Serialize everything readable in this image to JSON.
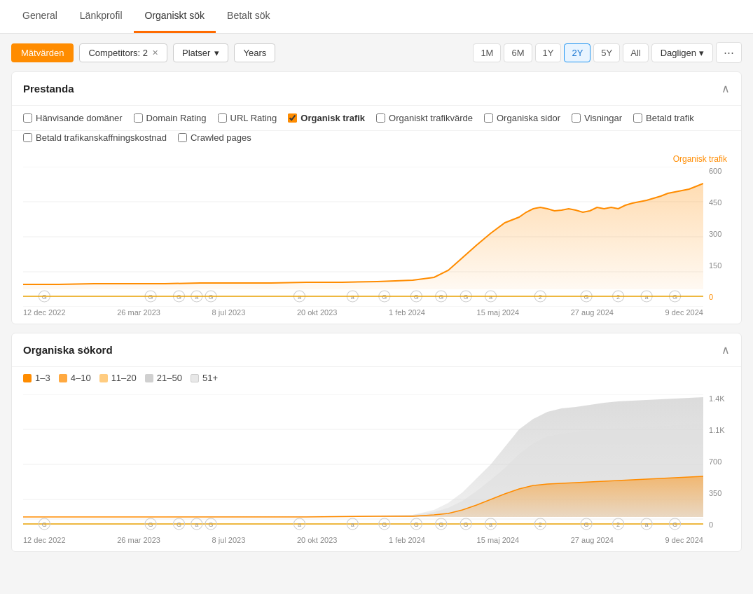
{
  "tabs": [
    {
      "label": "General",
      "active": false
    },
    {
      "label": "Länkprofil",
      "active": false
    },
    {
      "label": "Organiskt sök",
      "active": true
    },
    {
      "label": "Betalt sök",
      "active": false
    }
  ],
  "toolbar": {
    "metrics_label": "Mätvärden",
    "competitors_label": "Competitors: 2",
    "platser_label": "Platser",
    "years_label": "Years",
    "time_buttons": [
      "1M",
      "6M",
      "1Y",
      "2Y",
      "5Y",
      "All"
    ],
    "active_time": "2Y",
    "dagligen_label": "Dagligen",
    "more_icon": "⋯"
  },
  "prestanda": {
    "title": "Prestanda",
    "checkboxes": [
      {
        "label": "Hänvisande domäner",
        "checked": false
      },
      {
        "label": "Domain Rating",
        "checked": false
      },
      {
        "label": "URL Rating",
        "checked": false
      },
      {
        "label": "Organisk trafik",
        "checked": true,
        "highlight": true
      },
      {
        "label": "Organiskt trafikvärde",
        "checked": false
      },
      {
        "label": "Organiska sidor",
        "checked": false
      },
      {
        "label": "Visningar",
        "checked": false
      },
      {
        "label": "Betald trafik",
        "checked": false
      }
    ],
    "checkboxes2": [
      {
        "label": "Betald trafikanskaffningskostnad",
        "checked": false
      },
      {
        "label": "Crawled pages",
        "checked": false
      }
    ],
    "chart_label": "Organisk trafik",
    "y_axis": [
      "600",
      "450",
      "300",
      "150",
      "0"
    ],
    "x_axis": [
      "12 dec 2022",
      "26 mar 2023",
      "8 jul 2023",
      "20 okt 2023",
      "1 feb 2024",
      "15 maj 2024",
      "27 aug 2024",
      "9 dec 2024"
    ]
  },
  "organiska_sokord": {
    "title": "Organiska sökord",
    "legend": [
      {
        "label": "1–3",
        "color": "#ff8c00"
      },
      {
        "label": "4–10",
        "color": "#ffa940"
      },
      {
        "label": "11–20",
        "color": "#ffcc80"
      },
      {
        "label": "21–50",
        "color": "#e0e0e0"
      },
      {
        "label": "51+",
        "color": "#f0f0f0"
      }
    ],
    "y_axis": [
      "1.4K",
      "1.1K",
      "700",
      "350",
      "0"
    ],
    "x_axis": [
      "12 dec 2022",
      "26 mar 2023",
      "8 jul 2023",
      "20 okt 2023",
      "1 feb 2024",
      "15 maj 2024",
      "27 aug 2024",
      "9 dec 2024"
    ]
  }
}
